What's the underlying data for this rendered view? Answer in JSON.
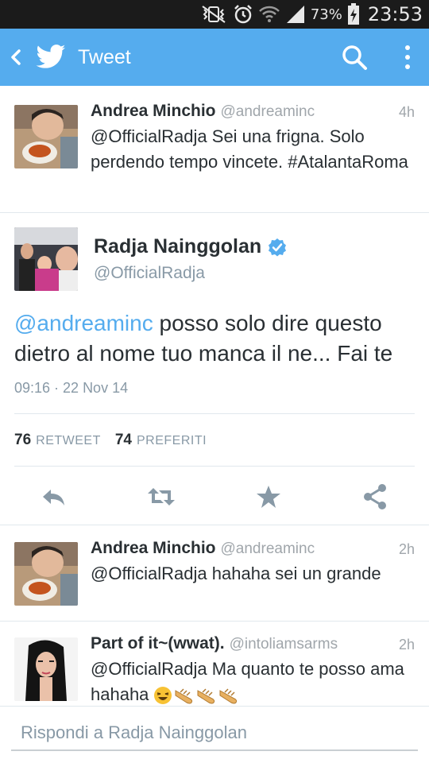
{
  "status_bar": {
    "battery": "73%",
    "time": "23:53"
  },
  "app_bar": {
    "title": "Tweet"
  },
  "tweets": [
    {
      "name": "Andrea Minchio",
      "handle": "@andreaminc",
      "time": "4h",
      "text": "@OfficialRadja Sei una frigna. Solo perdendo tempo vincete. #AtalantaRoma"
    }
  ],
  "main_tweet": {
    "name": "Radja Nainggolan",
    "handle": "@OfficialRadja",
    "mention": "@andreaminc",
    "text": " posso solo dire questo dietro al nome tuo manca il ne... Fai te",
    "date": "09:16 · 22 Nov 14",
    "retweet_count": "76",
    "retweet_label": "RETWEET",
    "fav_count": "74",
    "fav_label": "PREFERITI"
  },
  "replies": [
    {
      "name": "Andrea Minchio",
      "handle": "@andreaminc",
      "time": "2h",
      "text": "@OfficialRadja hahaha sei un grande"
    },
    {
      "name": "Part of it~(wwat).",
      "handle": "@intoliamsarms",
      "time": "2h",
      "text": "@OfficialRadja Ma quanto te posso ama hahaha"
    }
  ],
  "reply_bar": {
    "placeholder": "Rispondi a Radja Nainggolan"
  },
  "colors": {
    "brand": "#55acee",
    "status_bar": "#1b1b1b",
    "verified": "#55acee"
  }
}
